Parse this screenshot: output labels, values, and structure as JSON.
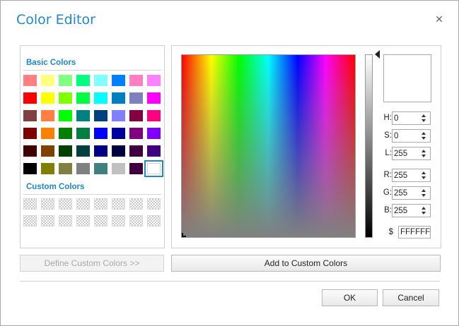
{
  "window": {
    "title": "Color Editor"
  },
  "basic_colors": {
    "label": "Basic Colors",
    "rows": [
      [
        "#ff8080",
        "#ffff80",
        "#80ff80",
        "#00ff80",
        "#80ffff",
        "#0080ff",
        "#ff80c0",
        "#ff80ff"
      ],
      [
        "#ff0000",
        "#ffff00",
        "#80ff00",
        "#00ff40",
        "#00ffff",
        "#0080c0",
        "#8080c0",
        "#ff00ff"
      ],
      [
        "#804040",
        "#ff8040",
        "#00ff00",
        "#008080",
        "#004080",
        "#8080ff",
        "#800040",
        "#ff0080"
      ],
      [
        "#800000",
        "#ff8000",
        "#008000",
        "#008040",
        "#0000ff",
        "#0000a0",
        "#800080",
        "#8000ff"
      ],
      [
        "#400000",
        "#804000",
        "#004000",
        "#004040",
        "#000080",
        "#000040",
        "#400040",
        "#400080"
      ],
      [
        "#000000",
        "#808000",
        "#808040",
        "#808080",
        "#408080",
        "#c0c0c0",
        "#400040",
        "#ffffff"
      ]
    ],
    "selected": "#ffffff"
  },
  "custom_colors": {
    "label": "Custom Colors",
    "rows": 2,
    "cols": 8
  },
  "fields": {
    "h": {
      "label": "H:",
      "value": "0"
    },
    "s": {
      "label": "S:",
      "value": "0"
    },
    "l": {
      "label": "L:",
      "value": "255"
    },
    "r": {
      "label": "R:",
      "value": "255"
    },
    "g": {
      "label": "G:",
      "value": "255"
    },
    "b": {
      "label": "B:",
      "value": "255"
    }
  },
  "hex": {
    "prefix": "$",
    "value": "FFFFFF"
  },
  "preview_color": "#ffffff",
  "buttons": {
    "define_custom": "Define Custom Colors >>",
    "add_custom": "Add to Custom Colors",
    "ok": "OK",
    "cancel": "Cancel"
  },
  "icons": {
    "close": "close-icon"
  }
}
